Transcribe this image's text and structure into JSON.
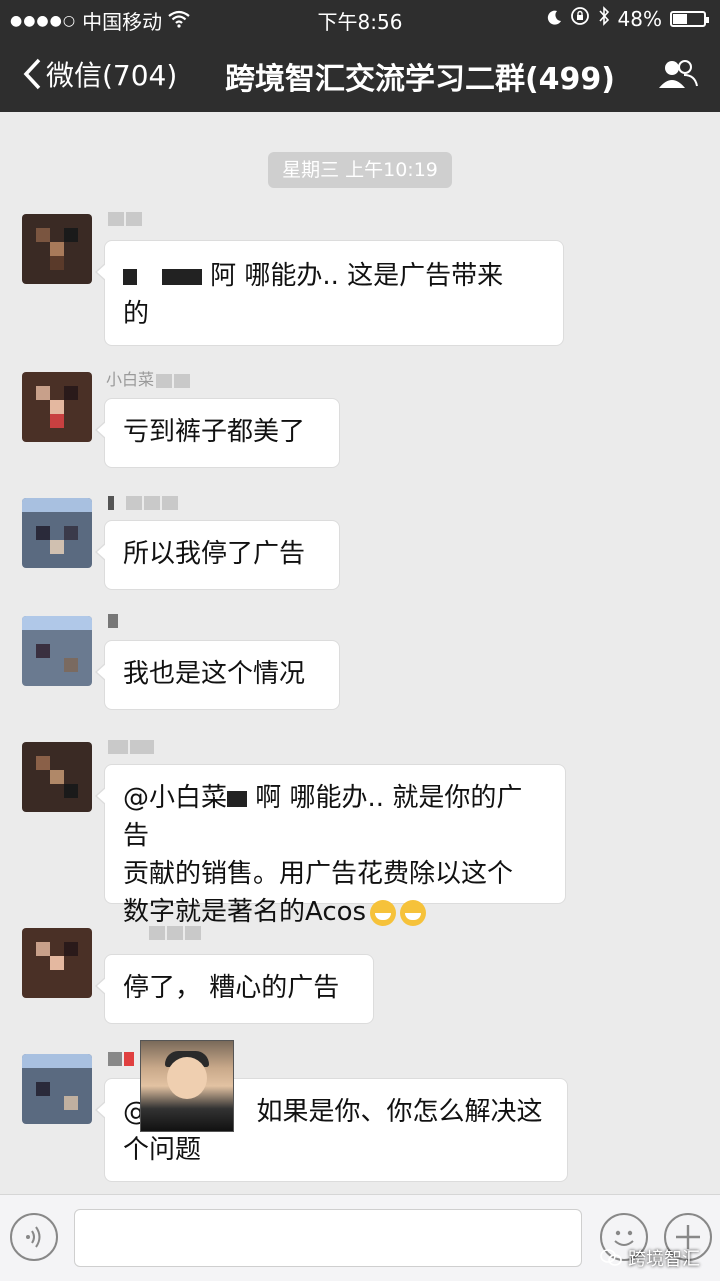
{
  "status_bar": {
    "signal_dots": "●●●●○",
    "carrier": "中国移动",
    "time": "下午8:56",
    "battery": "48%",
    "battery_level": 0.48
  },
  "nav": {
    "back_label": "微信(704)",
    "title": "跨境智汇交流学习二群(499)"
  },
  "chat": {
    "timestamp": "星期三 上午10:19",
    "messages": [
      {
        "name": "",
        "line1_tail": "阿 哪能办.. 这是广告带来",
        "line2": "的"
      },
      {
        "name": "小白菜",
        "text": "亏到裤子都美了"
      },
      {
        "name": "",
        "text": "所以我停了广告"
      },
      {
        "name": "",
        "text": "我也是这个情况"
      },
      {
        "name": "",
        "line1_head": "@小白菜",
        "line1_tail": "啊 哪能办.. 就是你的广告",
        "line2": "贡献的销售。用广告花费除以这个",
        "line3": "数字就是著名的Acos"
      },
      {
        "name": "",
        "text": "停了， 糟心的广告"
      },
      {
        "name": "",
        "line1_head": "@",
        "line1_tail": "如果是你、你怎么解决这",
        "line2": "个问题"
      }
    ]
  },
  "watermark": "跨境智汇",
  "icons": [
    "back-chevron-icon",
    "members-icon",
    "voice-icon",
    "emoji-icon",
    "plus-icon",
    "wifi-icon",
    "moon-icon",
    "lock-rotation-icon",
    "bluetooth-icon"
  ]
}
